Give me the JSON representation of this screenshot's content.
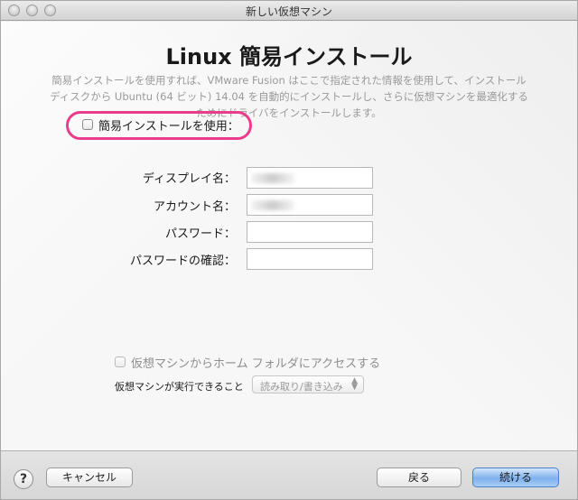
{
  "window": {
    "title": "新しい仮想マシン"
  },
  "page": {
    "heading": "Linux 簡易インストール",
    "description_line1": "簡易インストールを使用すれば、VMware Fusion はここで指定された情報を使用して、インストール",
    "description_line2": "ディスクから Ubuntu (64 ビット) 14.04 を自動的にインストールし、さらに仮想マシンを最適化する",
    "description_line3": "ためにドライバをインストールします。"
  },
  "form": {
    "easy_install_label": "簡易インストールを使用：",
    "easy_install_checked": false,
    "display_name_label": "ディスプレイ名：",
    "account_name_label": "アカウント名：",
    "password_label": "パスワード：",
    "password_confirm_label": "パスワードの確認："
  },
  "sharing": {
    "home_folder_label": "仮想マシンからホーム フォルダにアクセスする",
    "home_folder_checked": false,
    "vm_can_label": "仮想マシンが実行できること",
    "permission_value": "読み取り/書き込み"
  },
  "buttons": {
    "help": "?",
    "cancel": "キャンセル",
    "back": "戻る",
    "continue": "続ける"
  },
  "colors": {
    "highlight_ring": "#ea3c8a",
    "default_button": "#7fb1ec"
  }
}
